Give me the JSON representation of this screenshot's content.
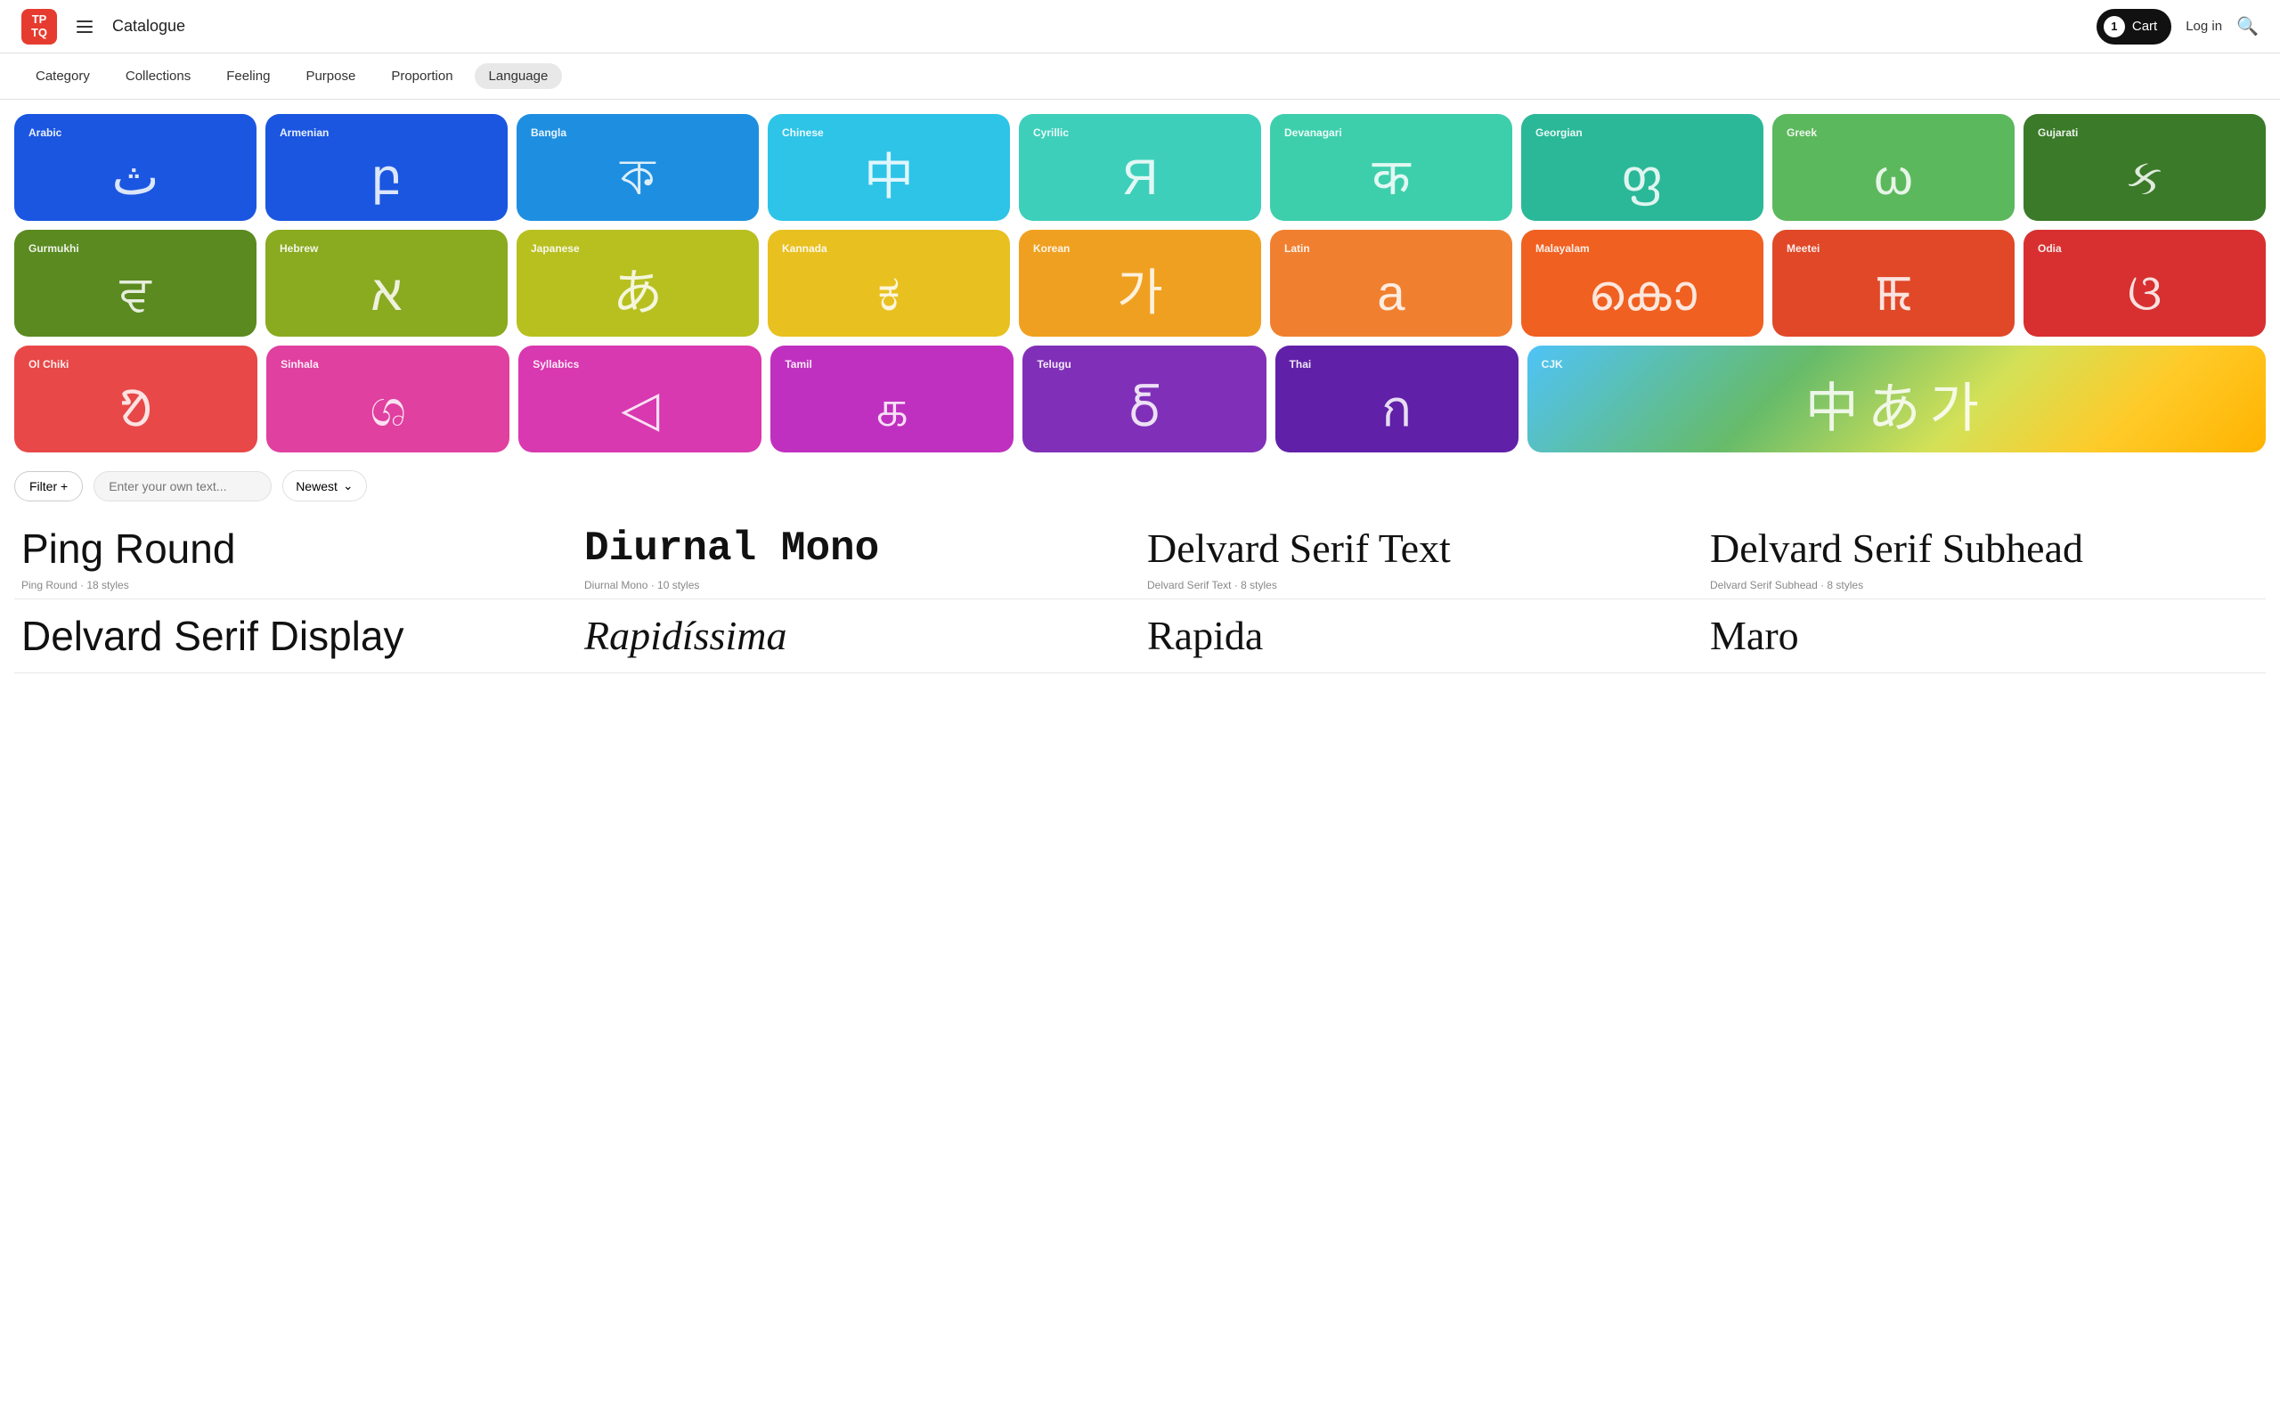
{
  "header": {
    "logo": "TP\nTQ",
    "title": "Catalogue",
    "cart_count": "1",
    "cart_label": "Cart",
    "login_label": "Log in"
  },
  "nav": {
    "tabs": [
      {
        "id": "category",
        "label": "Category",
        "active": false
      },
      {
        "id": "collections",
        "label": "Collections",
        "active": false
      },
      {
        "id": "feeling",
        "label": "Feeling",
        "active": false
      },
      {
        "id": "purpose",
        "label": "Purpose",
        "active": false
      },
      {
        "id": "proportion",
        "label": "Proportion",
        "active": false
      },
      {
        "id": "language",
        "label": "Language",
        "active": true
      }
    ]
  },
  "languages_row1": [
    {
      "id": "arabic",
      "label": "Arabic",
      "glyph": "ث",
      "color": "#1a56e0"
    },
    {
      "id": "armenian",
      "label": "Armenian",
      "glyph": "բ",
      "color": "#1a56e0"
    },
    {
      "id": "bangla",
      "label": "Bangla",
      "glyph": "ক",
      "color": "#1e8fe0"
    },
    {
      "id": "chinese",
      "label": "Chinese",
      "glyph": "中",
      "color": "#2ec4e8"
    },
    {
      "id": "cyrillic",
      "label": "Cyrillic",
      "glyph": "Я",
      "color": "#3ecfbb"
    },
    {
      "id": "devanagari",
      "label": "Devanagari",
      "glyph": "क",
      "color": "#3dcfab"
    },
    {
      "id": "georgian",
      "label": "Georgian",
      "glyph": "ფ",
      "color": "#2ab898"
    },
    {
      "id": "greek",
      "label": "Greek",
      "glyph": "ω",
      "color": "#5cb85c"
    },
    {
      "id": "gujarati",
      "label": "Gujarati",
      "glyph": "ક",
      "color": "#3a7a28"
    }
  ],
  "languages_row2": [
    {
      "id": "gurmukhi",
      "label": "Gurmukhi",
      "glyph": "ਵ",
      "color": "#5a8a20"
    },
    {
      "id": "hebrew",
      "label": "Hebrew",
      "glyph": "א",
      "color": "#8aaa20"
    },
    {
      "id": "japanese",
      "label": "Japanese",
      "glyph": "あ",
      "color": "#b8c020"
    },
    {
      "id": "kannada",
      "label": "Kannada",
      "glyph": "ಕ",
      "color": "#e8c020"
    },
    {
      "id": "korean",
      "label": "Korean",
      "glyph": "가",
      "color": "#f0a020"
    },
    {
      "id": "latin",
      "label": "Latin",
      "glyph": "a",
      "color": "#f08030"
    },
    {
      "id": "malayalam",
      "label": "Malayalam",
      "glyph": "കൊ",
      "color": "#f06020"
    },
    {
      "id": "meetei",
      "label": "Meetei",
      "glyph": "ꯃ",
      "color": "#e04828"
    },
    {
      "id": "odia",
      "label": "Odia",
      "glyph": "ଓ",
      "color": "#d83030"
    }
  ],
  "languages_row3": [
    {
      "id": "ol-chiki",
      "label": "Ol Chiki",
      "glyph": "ᱚ",
      "color": "#e84848"
    },
    {
      "id": "sinhala",
      "label": "Sinhala",
      "glyph": "ශ",
      "color": "#e040a0"
    },
    {
      "id": "syllabics",
      "label": "Syllabics",
      "glyph": "◁",
      "color": "#d838b0"
    },
    {
      "id": "tamil",
      "label": "Tamil",
      "glyph": "க",
      "color": "#c030c0"
    },
    {
      "id": "telugu",
      "label": "Telugu",
      "glyph": "ర్",
      "color": "#8030b8"
    },
    {
      "id": "thai",
      "label": "Thai",
      "glyph": "ก",
      "color": "#6020a8"
    },
    {
      "id": "cjk-label",
      "label": "CJK",
      "glyph": "中あ가",
      "color": null,
      "gradient": true,
      "wide": true
    }
  ],
  "filter": {
    "filter_label": "Filter +",
    "text_placeholder": "Enter your own text...",
    "sort_label": "Newest",
    "sort_arrow": "↓"
  },
  "fonts": [
    {
      "name": "Ping Round",
      "style": "normal",
      "meta_family": "Ping Round",
      "meta_styles": "18 styles"
    },
    {
      "name": "Diurnal Mono",
      "style": "mono",
      "meta_family": "Diurnal Mono",
      "meta_styles": "10 styles"
    },
    {
      "name": "Delvard Serif Text",
      "style": "serif",
      "meta_family": "Delvard Serif Text",
      "meta_styles": "8 styles"
    },
    {
      "name": "Delvard Serif Subhead",
      "style": "serif",
      "meta_family": "Delvard Serif Subhead",
      "meta_styles": "8 styles"
    },
    {
      "name": "Delvard Serif Display",
      "style": "normal",
      "meta_family": "Delvard Serif Display",
      "meta_styles": ""
    },
    {
      "name": "Rapidíssima",
      "style": "italic-serif",
      "meta_family": "Rapidíssima",
      "meta_styles": ""
    },
    {
      "name": "Rapida",
      "style": "serif",
      "meta_family": "Rapida",
      "meta_styles": ""
    },
    {
      "name": "Maro",
      "style": "serif",
      "meta_family": "Maro",
      "meta_styles": ""
    }
  ]
}
